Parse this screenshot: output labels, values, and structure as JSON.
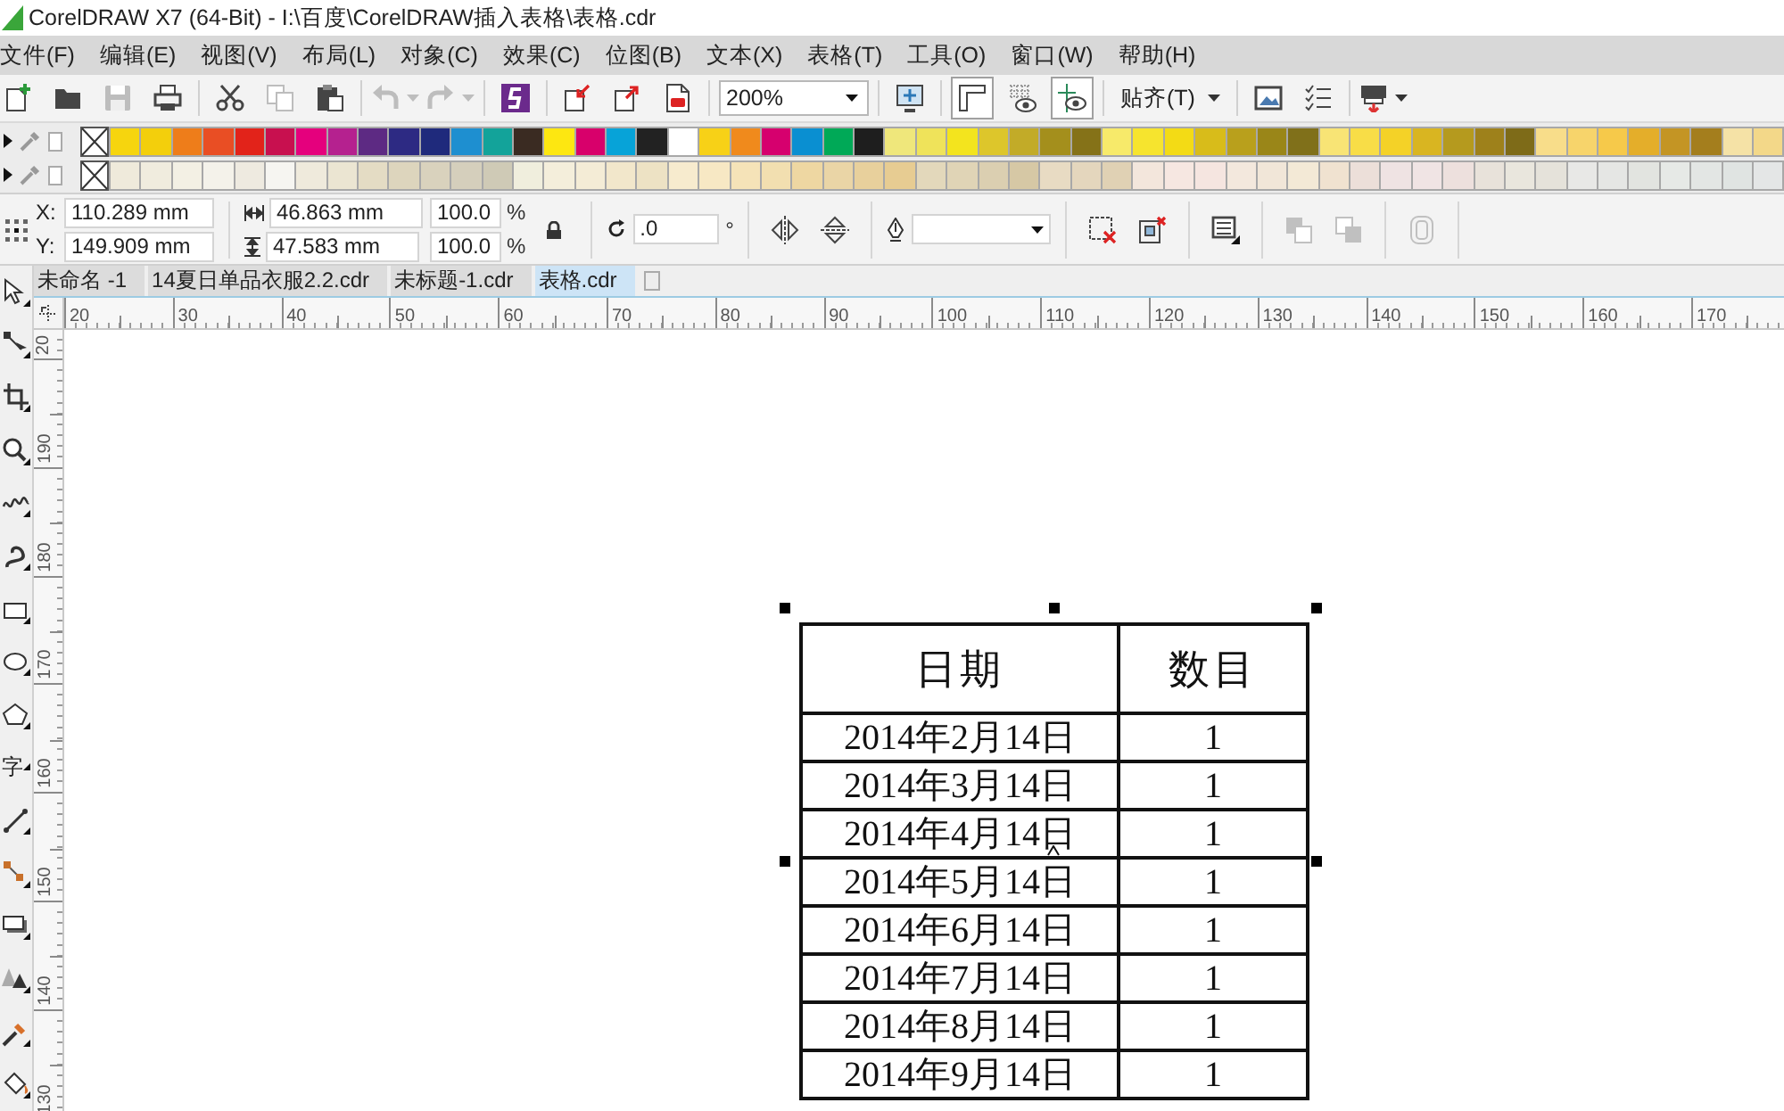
{
  "window": {
    "title": "CorelDRAW X7 (64-Bit) - I:\\百度\\CorelDRAW插入表格\\表格.cdr"
  },
  "menu": [
    "文件(F)",
    "编辑(E)",
    "视图(V)",
    "布局(L)",
    "对象(C)",
    "效果(C)",
    "位图(B)",
    "文本(X)",
    "表格(T)",
    "工具(O)",
    "窗口(W)",
    "帮助(H)"
  ],
  "toolbar": {
    "file_buttons": [
      {
        "kind": "new",
        "disabled": false
      },
      {
        "kind": "open",
        "disabled": false
      },
      {
        "kind": "save",
        "disabled": true
      },
      {
        "kind": "print",
        "disabled": false
      }
    ],
    "edit_buttons": [
      {
        "kind": "cut",
        "disabled": false
      },
      {
        "kind": "copy",
        "disabled": true
      },
      {
        "kind": "paste",
        "disabled": false
      }
    ],
    "history_buttons": [
      {
        "kind": "undo",
        "disabled": true
      },
      {
        "kind": "redo",
        "disabled": true
      }
    ],
    "connect_buttons": [
      {
        "kind": "connect",
        "disabled": false
      }
    ],
    "transfer_buttons": [
      {
        "kind": "import",
        "disabled": false
      },
      {
        "kind": "export",
        "disabled": false
      },
      {
        "kind": "publish-pdf",
        "disabled": false
      }
    ],
    "zoom_level": "200%",
    "zoom_buttons": [
      {
        "kind": "full-screen",
        "disabled": false
      }
    ],
    "view_toggles": [
      {
        "kind": "rulers",
        "on": true
      },
      {
        "kind": "grid",
        "on": false
      },
      {
        "kind": "guidelines",
        "on": true
      }
    ],
    "snap_menu": "贴齐(T)",
    "option_buttons": [
      {
        "kind": "options",
        "disabled": false
      },
      {
        "kind": "application-options",
        "disabled": false
      }
    ],
    "launch_buttons": [
      {
        "kind": "launch",
        "disabled": false
      }
    ]
  },
  "palettes": [
    {
      "colors": [
        {
          "color": "#f6d50e"
        },
        {
          "color": "#f3cf0c"
        },
        {
          "color": "#ee7d1a"
        },
        {
          "color": "#e94e24"
        },
        {
          "color": "#e2231a"
        },
        {
          "color": "#c8104f"
        },
        {
          "color": "#e5007d"
        },
        {
          "color": "#b5218f"
        },
        {
          "color": "#5d2a83"
        },
        {
          "color": "#2d2a83"
        },
        {
          "color": "#1f2a7c"
        },
        {
          "color": "#1e8fd0"
        },
        {
          "color": "#13a39a"
        },
        {
          "color": "#3a2b22"
        },
        {
          "color": "#fde711"
        },
        {
          "color": "#d8006b"
        },
        {
          "color": "#07a3d8"
        },
        {
          "color": "#222222"
        },
        {
          "color": "#ffffff"
        },
        {
          "color": "#f7d117"
        },
        {
          "color": "#f08a1c"
        },
        {
          "color": "#d6006e"
        },
        {
          "color": "#0a8fd1"
        },
        {
          "color": "#00a957"
        },
        {
          "color": "#1e1e1e"
        },
        {
          "color": "#efe77b"
        },
        {
          "color": "#efe35a"
        },
        {
          "color": "#f3e41e"
        },
        {
          "color": "#ddc62b"
        },
        {
          "color": "#c2ab28"
        },
        {
          "color": "#a48f1c"
        },
        {
          "color": "#857218"
        },
        {
          "color": "#f7ea6a"
        },
        {
          "color": "#f6e42e"
        },
        {
          "color": "#f3db15"
        },
        {
          "color": "#d8bc1a"
        },
        {
          "color": "#b9a01c"
        },
        {
          "color": "#9a8618"
        },
        {
          "color": "#80701a"
        },
        {
          "color": "#f8e475"
        },
        {
          "color": "#f8dd47"
        },
        {
          "color": "#f4d227"
        },
        {
          "color": "#d9b521"
        },
        {
          "color": "#b59a1e"
        },
        {
          "color": "#9e811b"
        },
        {
          "color": "#7e6b18"
        },
        {
          "color": "#f8dd8a"
        },
        {
          "color": "#f7d46b"
        },
        {
          "color": "#f6c94a"
        },
        {
          "color": "#e4ae2a"
        },
        {
          "color": "#c49524"
        },
        {
          "color": "#a47e1d"
        },
        {
          "color": "#f5e2a6"
        },
        {
          "color": "#f3d889"
        }
      ]
    },
    {
      "colors": [
        {
          "color": "#efeadb"
        },
        {
          "color": "#f0ecde"
        },
        {
          "color": "#f3f0e4"
        },
        {
          "color": "#f4f2ea"
        },
        {
          "color": "#eeeae0"
        },
        {
          "color": "#f6f5f1"
        },
        {
          "color": "#efeadc"
        },
        {
          "color": "#ebe5d2"
        },
        {
          "color": "#e4dcc4"
        },
        {
          "color": "#ddd5bd"
        },
        {
          "color": "#d9d2bd"
        },
        {
          "color": "#d5cfbc"
        },
        {
          "color": "#cfcab6"
        },
        {
          "color": "#f0eedd"
        },
        {
          "color": "#f4eedb"
        },
        {
          "color": "#f4ecd6"
        },
        {
          "color": "#f2e7cb"
        },
        {
          "color": "#ede2c4"
        },
        {
          "color": "#f7ebce"
        },
        {
          "color": "#f7e8c4"
        },
        {
          "color": "#f5e3b8"
        },
        {
          "color": "#f2dfb0"
        },
        {
          "color": "#eed7a2"
        },
        {
          "color": "#ead5a6"
        },
        {
          "color": "#e8d09c"
        },
        {
          "color": "#e7cc92"
        },
        {
          "color": "#e3d8bb"
        },
        {
          "color": "#e0d4b6"
        },
        {
          "color": "#dbcfb1"
        },
        {
          "color": "#d6c8a5"
        },
        {
          "color": "#e8dbc3"
        },
        {
          "color": "#e4d6bd"
        },
        {
          "color": "#e0d1b4"
        },
        {
          "color": "#f3e6dc"
        },
        {
          "color": "#f6e7e1"
        },
        {
          "color": "#f5e5e0"
        },
        {
          "color": "#f3e8dd"
        },
        {
          "color": "#f1e6d8"
        },
        {
          "color": "#f3e9d6"
        },
        {
          "color": "#f0e2d0"
        },
        {
          "color": "#ecdfd9"
        },
        {
          "color": "#efe3e3"
        },
        {
          "color": "#f0e4e4"
        },
        {
          "color": "#ede0dd"
        },
        {
          "color": "#e8e2da"
        },
        {
          "color": "#e9e6dd"
        },
        {
          "color": "#e5e2da"
        },
        {
          "color": "#e8e8e6"
        },
        {
          "color": "#e5e6e4"
        },
        {
          "color": "#e2e4e0"
        },
        {
          "color": "#e6e9e6"
        },
        {
          "color": "#e3e6e4"
        },
        {
          "color": "#e0e4e2"
        },
        {
          "color": "#e4e6e6"
        }
      ]
    }
  ],
  "property_bar": {
    "position": [
      {
        "label": "X:",
        "value": "110.289 mm"
      },
      {
        "label": "Y:",
        "value": "149.909 mm"
      }
    ],
    "size": [
      {
        "value": "46.863 mm"
      },
      {
        "value": "47.583 mm"
      }
    ],
    "scale": [
      {
        "value": "100.0",
        "unit": "%"
      },
      {
        "value": "100.0",
        "unit": "%"
      }
    ],
    "rotation": {
      "value": ".0",
      "unit": "°"
    },
    "mirror_buttons": [
      {
        "kind": "mirror-horizontal",
        "disabled": false
      },
      {
        "kind": "mirror-vertical",
        "disabled": false
      }
    ],
    "tool_groups": [
      [
        {
          "kind": "clear-transform",
          "disabled": false
        },
        {
          "kind": "clear-envelope",
          "disabled": false
        }
      ],
      [
        {
          "kind": "wrap",
          "disabled": false
        }
      ],
      [
        {
          "kind": "combine",
          "disabled": true
        },
        {
          "kind": "weld",
          "disabled": true
        }
      ],
      [
        {
          "kind": "outline",
          "disabled": true
        }
      ]
    ]
  },
  "toolbox": {
    "text_tool": "字"
  },
  "tabs": [
    {
      "label": "未命名 -1",
      "selected": false
    },
    {
      "label": "14夏日单品衣服2.2.cdr",
      "selected": false
    },
    {
      "label": "未标题-1.cdr",
      "selected": false
    },
    {
      "label": "表格.cdr",
      "selected": true
    }
  ],
  "rulers": {
    "horizontal": [
      "20",
      "30",
      "40",
      "50",
      "60",
      "70",
      "80",
      "90",
      "100",
      "110",
      "120",
      "130",
      "140",
      "150",
      "160",
      "170"
    ],
    "vertical": [
      "20",
      "190",
      "180",
      "170",
      "160",
      "150",
      "140",
      "130"
    ]
  },
  "table": {
    "columns": [
      "日期",
      "数目"
    ],
    "rows": [
      [
        "2014年2月14日",
        "1"
      ],
      [
        "2014年3月14日",
        "1"
      ],
      [
        "2014年4月14日",
        "1"
      ],
      [
        "2014年5月14日",
        "1"
      ],
      [
        "2014年6月14日",
        "1"
      ],
      [
        "2014年7月14日",
        "1"
      ],
      [
        "2014年8月14日",
        "1"
      ],
      [
        "2014年9月14日",
        "1"
      ]
    ]
  }
}
